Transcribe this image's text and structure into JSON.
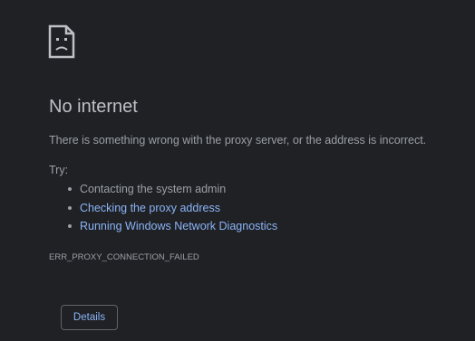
{
  "page": {
    "icon": "sad-document-icon",
    "title": "No internet",
    "message": "There is something wrong with the proxy server, or the address is incorrect.",
    "try_label": "Try:",
    "suggestions": [
      {
        "text": "Contacting the system admin",
        "is_link": false
      },
      {
        "text": "Checking the proxy address",
        "is_link": true
      },
      {
        "text": "Running Windows Network Diagnostics",
        "is_link": true
      }
    ],
    "error_code": "ERR_PROXY_CONNECTION_FAILED",
    "details_label": "Details"
  },
  "colors": {
    "background": "#202124",
    "title": "#bdc1c6",
    "text": "#9aa0a6",
    "link": "#8ab4f8",
    "button_border": "#5f6368"
  }
}
